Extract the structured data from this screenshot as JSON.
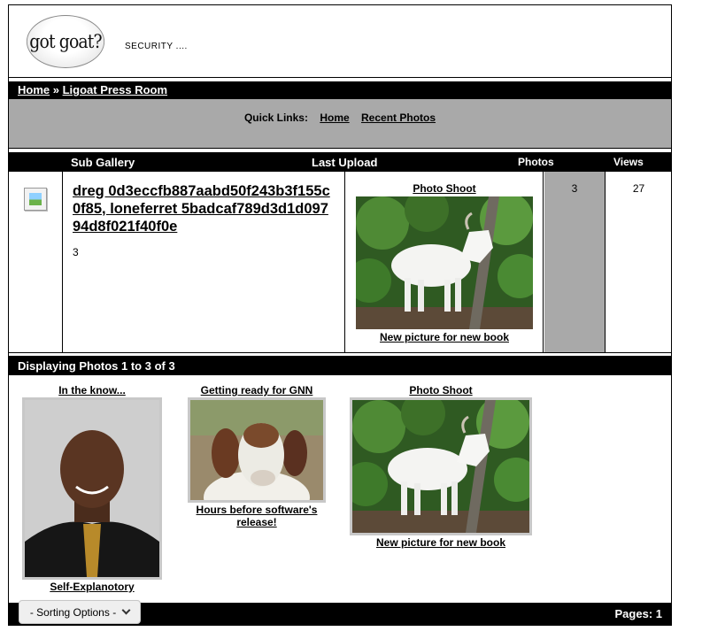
{
  "header": {
    "logo_text": "got goat?",
    "tagline": "SECURITY ...."
  },
  "breadcrumb": {
    "home": "Home",
    "separator": " » ",
    "current": "Ligoat Press Room"
  },
  "quick_links": {
    "label": "Quick Links:",
    "home": "Home",
    "recent": "Recent Photos"
  },
  "columns": {
    "sub_gallery": "Sub Gallery",
    "last_upload": "Last Upload",
    "photos": "Photos",
    "views": "Views"
  },
  "gallery_row": {
    "title": "dreg 0d3eccfb887aabd50f243b3f155c0f85, loneferret 5badcaf789d3d1d09794d8f021f40f0e",
    "count": "3",
    "last_upload_title": "Photo Shoot",
    "last_upload_caption": "New picture for new book",
    "photos": "3",
    "views": "27"
  },
  "display_text": "Displaying Photos 1 to 3 of 3",
  "photos": [
    {
      "title": "In the know...",
      "caption": "Self-Explanotory",
      "icon": "portrait-photo"
    },
    {
      "title": "Getting ready for GNN",
      "caption": "Hours before software's release!",
      "icon": "goat-closeup-photo"
    },
    {
      "title": "Photo Shoot",
      "caption": "New picture for new book",
      "icon": "white-goat-photo"
    }
  ],
  "footer": {
    "sort_label": "- Sorting Options -",
    "pages": "Pages: 1"
  }
}
